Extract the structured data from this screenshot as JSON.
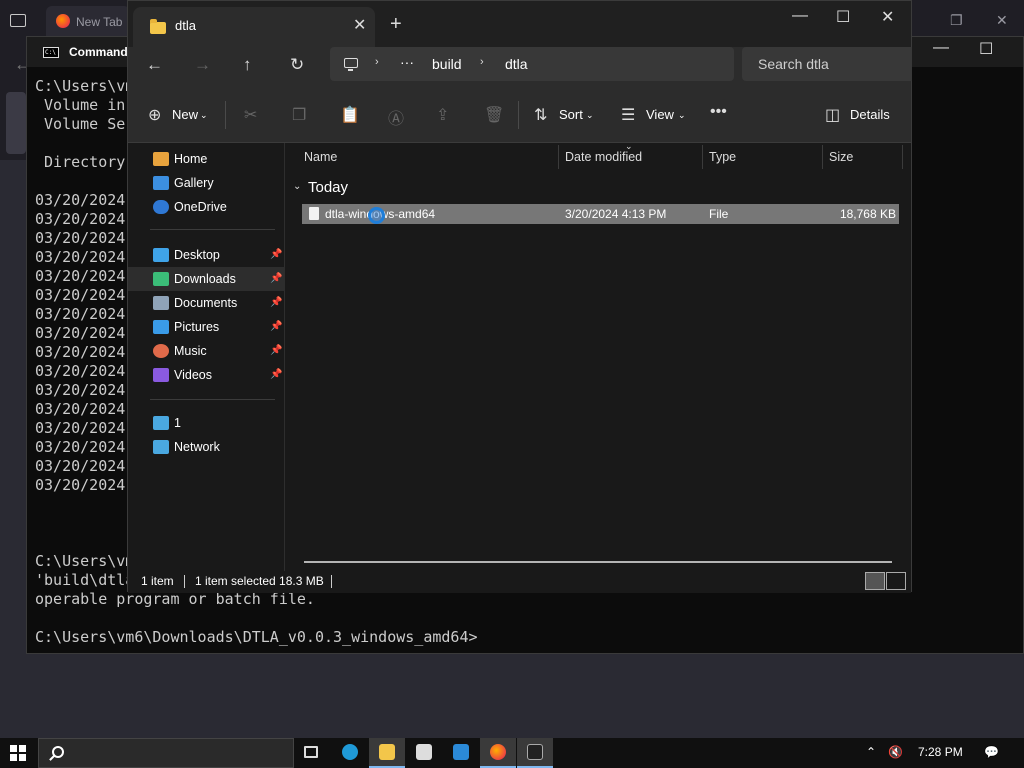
{
  "browser": {
    "tab_title": "New Tab"
  },
  "cmd": {
    "title": "Command",
    "line_path": "C:\\Users\\vm",
    "line_volume_in": " Volume in",
    "line_volume_ser": " Volume Ser",
    "line_directory": " Directory",
    "date_lines": [
      "03/20/2024",
      "03/20/2024",
      "03/20/2024",
      "03/20/2024",
      "03/20/2024",
      "03/20/2024",
      "03/20/2024",
      "03/20/2024",
      "03/20/2024",
      "03/20/2024",
      "03/20/2024",
      "03/20/2024",
      "03/20/2024",
      "03/20/2024",
      "03/20/2024",
      "03/20/2024"
    ],
    "line_path2": "C:\\Users\\vm",
    "line_build": "'build\\dtla",
    "line_operable": "operable program or batch file.",
    "prompt": "C:\\Users\\vm6\\Downloads\\DTLA_v0.0.3_windows_amd64>"
  },
  "explorer": {
    "tab_title": "dtla",
    "breadcrumb": [
      "build",
      "dtla"
    ],
    "search_placeholder": "Search dtla",
    "toolbar": {
      "new": "New",
      "sort": "Sort",
      "view": "View",
      "details": "Details"
    },
    "sidebar": {
      "items": [
        {
          "label": "Home",
          "icon": "home-icon",
          "color": "#e8a33d"
        },
        {
          "label": "Gallery",
          "icon": "gallery-icon",
          "color": "#3c8fe0"
        },
        {
          "label": "OneDrive",
          "icon": "onedrive-icon",
          "color": "#2f78d4"
        },
        {
          "label": "Desktop",
          "icon": "desktop-icon",
          "color": "#3fa3e8"
        },
        {
          "label": "Downloads",
          "icon": "downloads-icon",
          "color": "#3bbd78"
        },
        {
          "label": "Documents",
          "icon": "documents-icon",
          "color": "#8fa3b8"
        },
        {
          "label": "Pictures",
          "icon": "pictures-icon",
          "color": "#3a9be8"
        },
        {
          "label": "Music",
          "icon": "music-icon",
          "color": "#e06a4a"
        },
        {
          "label": "Videos",
          "icon": "videos-icon",
          "color": "#8a5ae0"
        },
        {
          "label": "1",
          "icon": "this-pc-icon",
          "color": "#4aa8e0"
        },
        {
          "label": "Network",
          "icon": "network-icon",
          "color": "#4aa8e0"
        }
      ]
    },
    "columns": [
      "Name",
      "Date modified",
      "Type",
      "Size"
    ],
    "group": "Today",
    "file": {
      "name": "dtla-windows-amd64",
      "date": "3/20/2024 4:13 PM",
      "type": "File",
      "size": "18,768 KB"
    },
    "status": {
      "count": "1 item",
      "selected": "1 item selected  18.3 MB"
    }
  },
  "taskbar": {
    "time": "7:28 PM"
  }
}
